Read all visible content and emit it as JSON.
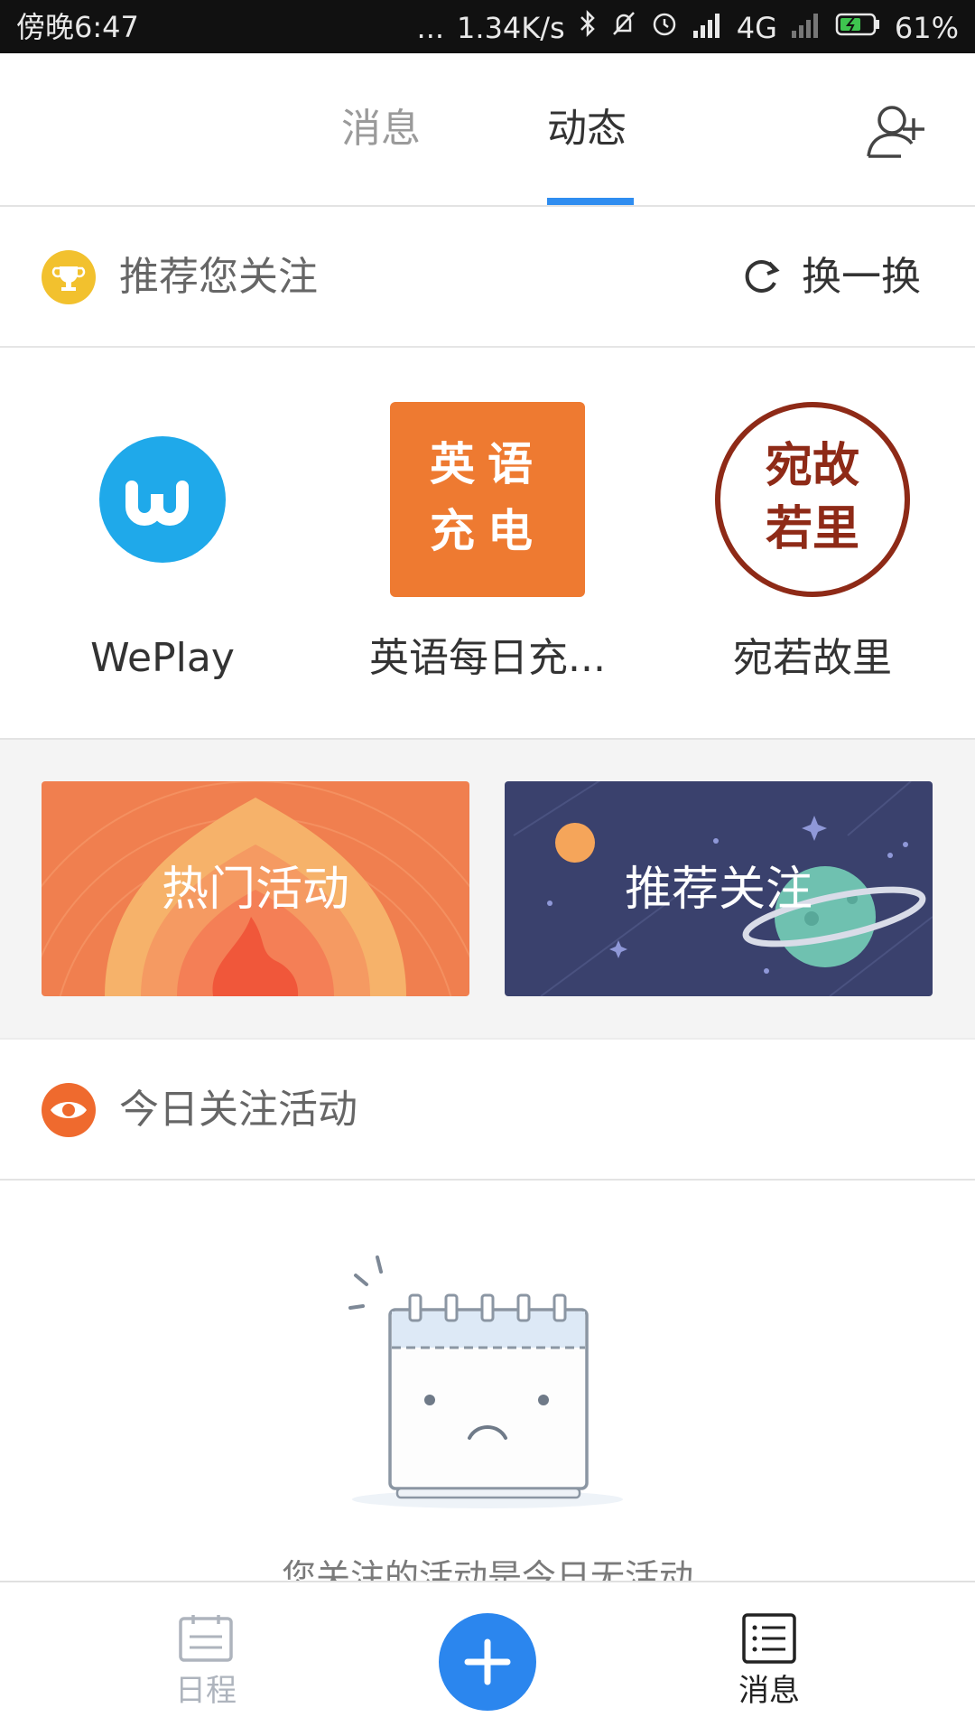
{
  "status_bar": {
    "time": "傍晚6:47",
    "dots": "...",
    "network_speed": "1.34K/s",
    "network_type": "4G",
    "battery": "61%"
  },
  "top_tabs": {
    "messages": "消息",
    "dynamics": "动态",
    "active": "动态",
    "add_user_icon": "add-user-icon"
  },
  "recommend": {
    "title": "推荐您关注",
    "refresh_label": "换一换",
    "icon": "trophy-icon",
    "accounts": [
      {
        "name": "WePlay",
        "avatar_text": "w",
        "color": "#1fa9ea"
      },
      {
        "name": "英语每日充...",
        "avatar_line1": "英语",
        "avatar_line2": "充电",
        "color": "#ee7a31"
      },
      {
        "name": "宛若故里",
        "avatar_line1": "宛故",
        "avatar_line2": "若里",
        "color": "#8e2a17"
      }
    ]
  },
  "banners": {
    "hot": "热门活动",
    "recommend": "推荐关注"
  },
  "today": {
    "title": "今日关注活动",
    "icon": "eye-icon",
    "empty_text": "您关注的活动是今日无活动"
  },
  "bottom_nav": {
    "schedule": "日程",
    "messages": "消息",
    "fab_icon": "plus-icon"
  }
}
